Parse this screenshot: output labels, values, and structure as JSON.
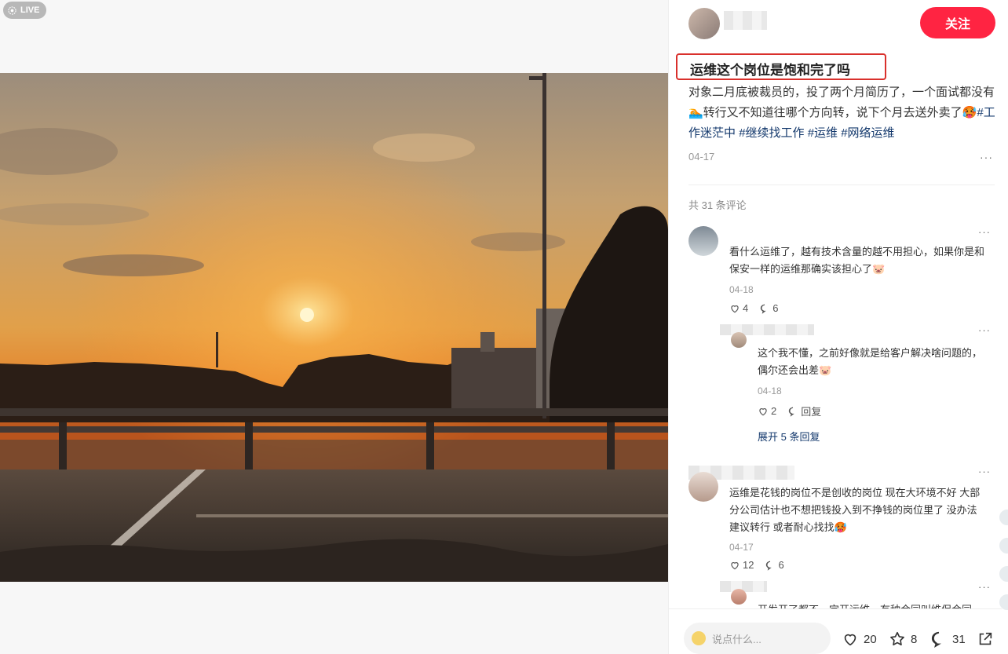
{
  "media": {
    "live_label": "LIVE",
    "photo_alt": ""
  },
  "author": {
    "follow_label": "关注"
  },
  "post": {
    "title": "运维这个岗位是饱和完了吗",
    "desc_text": "对象二月底被裁员的，投了两个月简历了，一个面试都没有🏊转行又不知道往哪个方向转，说下个月去送外卖了🥵",
    "tags": [
      "#工作迷茫中",
      "#继续找工作",
      "#运维",
      "#网络运维"
    ],
    "date": "04-17",
    "more": "···"
  },
  "comments_header": {
    "count_text": "共 31 条评论"
  },
  "comments": [
    {
      "text": "看什么运维了，越有技术含量的越不用担心，如果你是和保安一样的运维那确实该担心了🐷",
      "date": "04-18",
      "likes": "4",
      "replies": "6",
      "more": "···"
    },
    {
      "text": "这个我不懂，之前好像就是给客户解决啥问题的，偶尔还会出差🐷",
      "date": "04-18",
      "likes": "2",
      "reply_label": "回复",
      "more": "···"
    },
    {
      "text": "运维是花钱的岗位不是创收的岗位 现在大环境不好 大部分公司估计也不想把钱投入到不挣钱的岗位里了 没办法 建议转行 或者耐心找找🥵",
      "date": "04-17",
      "likes": "12",
      "replies": "6",
      "more": "···"
    },
    {
      "text": "开发开了都不一定开运维，有种合同叫维保合同",
      "more": "···"
    }
  ],
  "expand_replies": "展开 5 条回复",
  "bottom": {
    "input_placeholder": "说点什么...",
    "likes": "20",
    "stars": "8",
    "comments": "31"
  },
  "colors": {
    "accent": "#ff2442",
    "tag": "#13386c",
    "highlight_box": "#d9302c"
  }
}
